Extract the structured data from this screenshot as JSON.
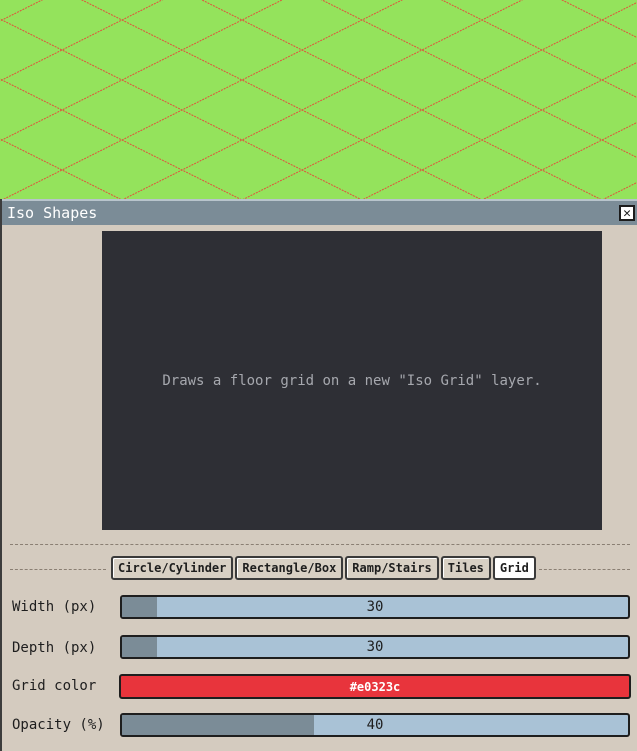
{
  "canvas": {
    "background_color": "#94e35c",
    "grid_color": "#e0523c"
  },
  "dialog": {
    "title": "Iso Shapes",
    "close_icon": "close-icon",
    "preview_text": "Draws a floor grid on a new \"Iso Grid\" layer."
  },
  "tabs": [
    {
      "label": "Circle/Cylinder",
      "active": false
    },
    {
      "label": "Rectangle/Box",
      "active": false
    },
    {
      "label": "Ramp/Stairs",
      "active": false
    },
    {
      "label": "Tiles",
      "active": false
    },
    {
      "label": "Grid",
      "active": true
    }
  ],
  "fields": {
    "width": {
      "label": "Width (px)",
      "value": "30",
      "fraction": 0.07
    },
    "depth": {
      "label": "Depth (px)",
      "value": "30",
      "fraction": 0.07
    },
    "grid_color": {
      "label": "Grid color",
      "value": "#e0323c",
      "color": "#e8343c"
    },
    "opacity": {
      "label": "Opacity (%)",
      "value": "40",
      "fraction": 0.38
    }
  }
}
